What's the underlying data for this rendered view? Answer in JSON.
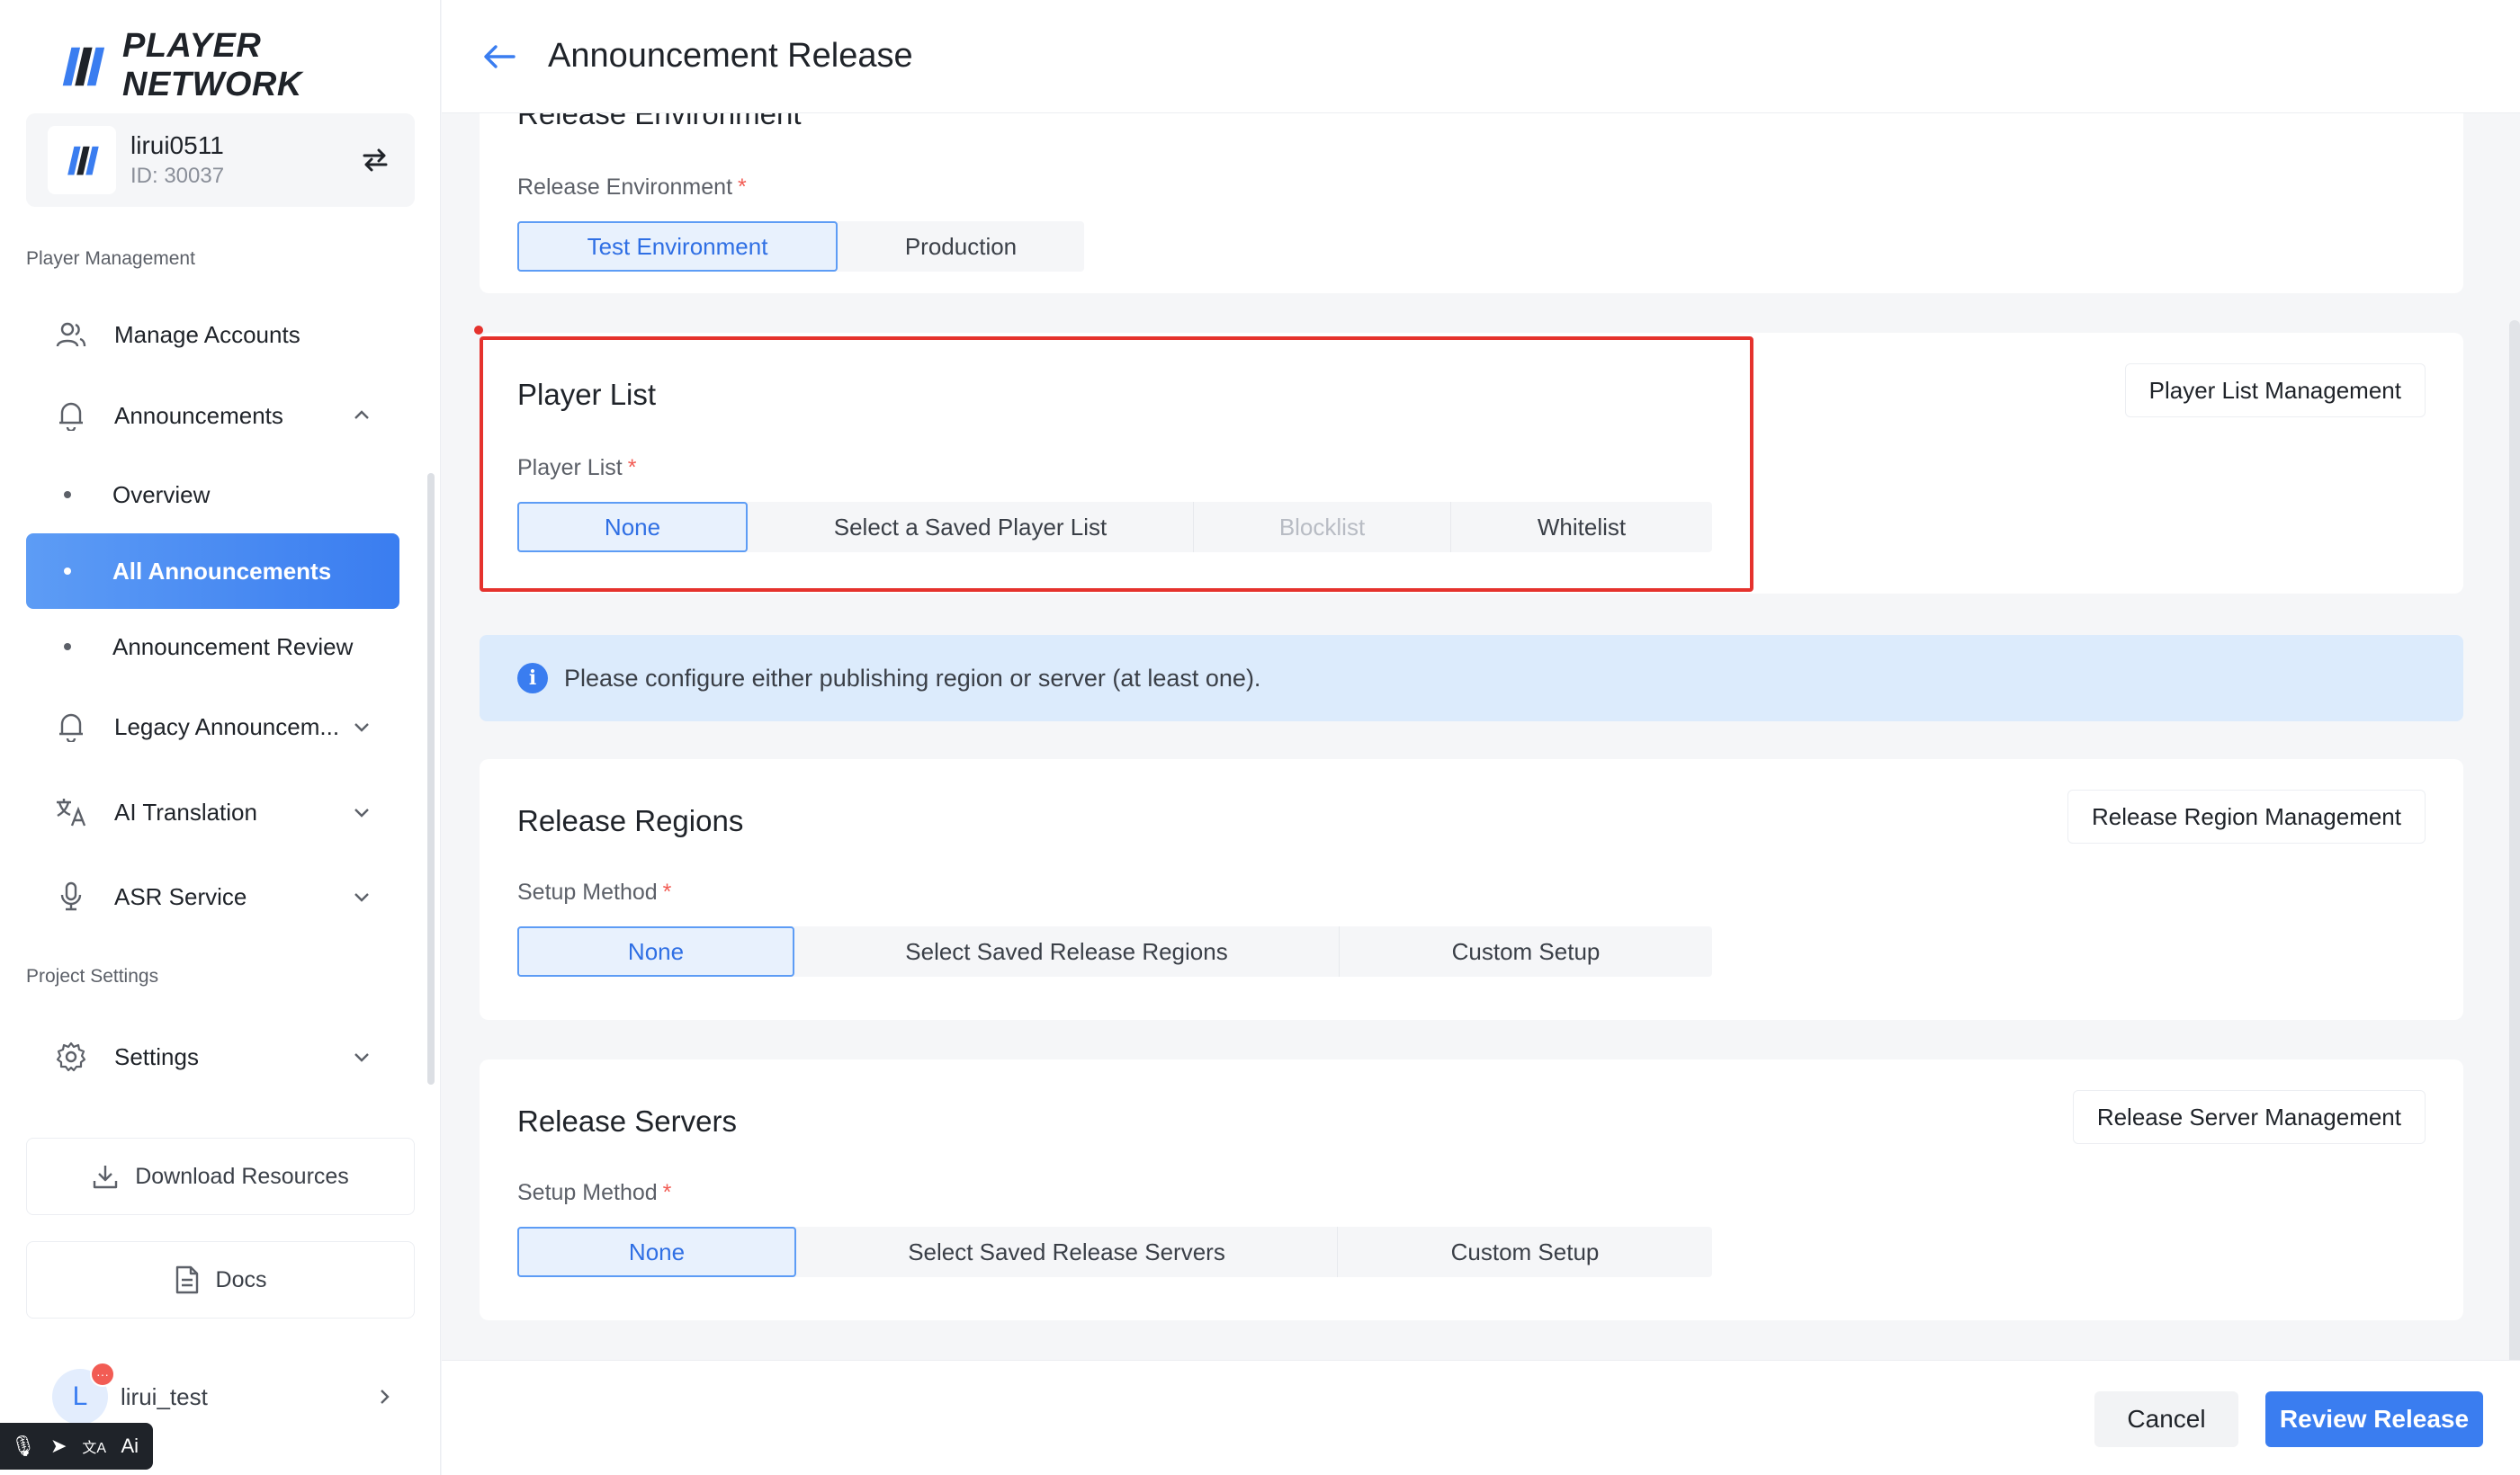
{
  "brand": {
    "name": "PLAYER NETWORK",
    "accent": "#3a7df0"
  },
  "account": {
    "name": "lirui0511",
    "id": "ID: 30037"
  },
  "sidebar": {
    "section_player": "Player Management",
    "section_project": "Project Settings",
    "items": {
      "manage_accounts": "Manage Accounts",
      "announcements": "Announcements",
      "overview": "Overview",
      "all_announcements": "All Announcements",
      "announcement_review": "Announcement Review",
      "legacy": "Legacy Announcem...",
      "ai_translation": "AI Translation",
      "asr": "ASR Service",
      "settings": "Settings"
    },
    "download": "Download Resources",
    "docs": "Docs",
    "user": {
      "initial": "L",
      "name": "lirui_test",
      "badge": "···"
    },
    "toolbar": {
      "t1": "🎙",
      "t2": "➤",
      "t3": "文A",
      "t4": "Ai"
    }
  },
  "header": {
    "title": "Announcement Release"
  },
  "release_env": {
    "heading_partial": "Release Environment",
    "label": "Release Environment",
    "required": "*",
    "options": [
      "Test Environment",
      "Production"
    ],
    "selected": "Test Environment"
  },
  "player_list": {
    "title": "Player List",
    "label": "Player List",
    "required": "*",
    "options": [
      "None",
      "Select a Saved Player List",
      "Blocklist",
      "Whitelist"
    ],
    "selected": "None",
    "disabled": "Blocklist",
    "management": "Player List Management"
  },
  "info": {
    "icon": "i",
    "text": "Please configure either publishing region or server (at least one)."
  },
  "regions": {
    "title": "Release Regions",
    "label": "Setup Method",
    "required": "*",
    "options": [
      "None",
      "Select Saved Release Regions",
      "Custom Setup"
    ],
    "selected": "None",
    "management": "Release Region Management"
  },
  "servers": {
    "title": "Release Servers",
    "label": "Setup Method",
    "required": "*",
    "options": [
      "None",
      "Select Saved Release Servers",
      "Custom Setup"
    ],
    "selected": "None",
    "management": "Release Server Management"
  },
  "footer": {
    "cancel": "Cancel",
    "review": "Review Release"
  }
}
